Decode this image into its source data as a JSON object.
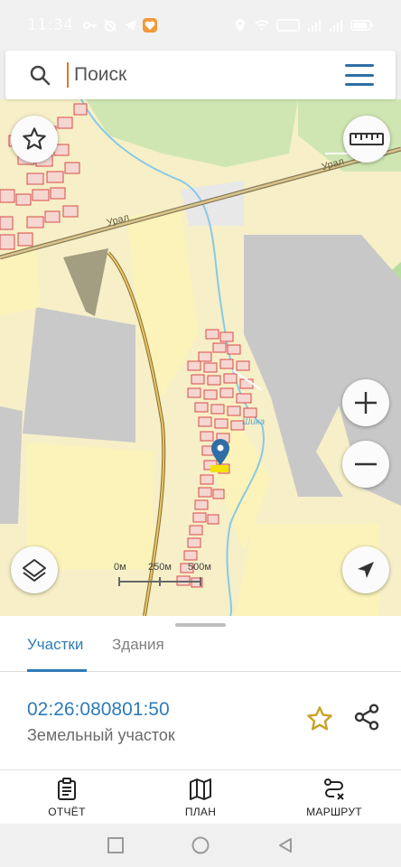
{
  "status_bar": {
    "time": "11:34",
    "icons_left": [
      "key-icon",
      "alarm-icon",
      "telegram-icon",
      "heart-app-icon"
    ],
    "icons_right": [
      "location-icon",
      "wifi-icon",
      "volte-icon",
      "signal-icon",
      "signal-icon",
      "battery-icon"
    ]
  },
  "search": {
    "placeholder": "Поиск",
    "value": ""
  },
  "map": {
    "road_label_1": "Урал",
    "road_label_2": "Урал",
    "river_label": "Шика",
    "scale": {
      "labels": [
        "0м",
        "250м",
        "500м"
      ]
    }
  },
  "sheet": {
    "tabs": [
      {
        "label": "Участки",
        "active": true
      },
      {
        "label": "Здания",
        "active": false
      }
    ],
    "plot": {
      "cadastral_number": "02:26:080801:50",
      "type": "Земельный участок"
    }
  },
  "bottom_nav": {
    "items": [
      {
        "label": "ОТЧЁТ",
        "icon": "report-icon"
      },
      {
        "label": "ПЛАН",
        "icon": "map-plan-icon"
      },
      {
        "label": "МАРШРУТ",
        "icon": "route-icon"
      }
    ]
  },
  "colors": {
    "accent": "#2f7bb8",
    "map_yellow": "#f6efc8",
    "map_field": "#fbf3b9",
    "map_gray": "#c8c8c8",
    "map_green": "#cfe6b3",
    "parcel_red": "#d94b4b",
    "star_gold": "#c9a227"
  }
}
